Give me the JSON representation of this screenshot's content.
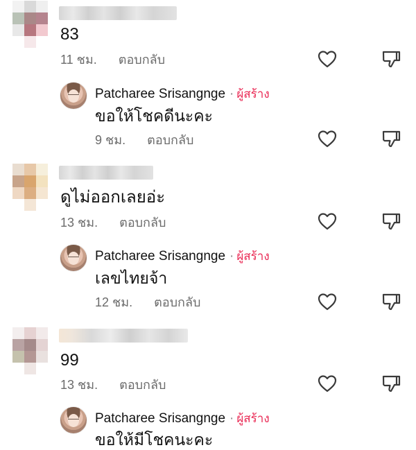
{
  "comments": [
    {
      "text": "83",
      "time": "11 ชม.",
      "reply_label": "ตอบกลับ",
      "reply": {
        "author": "Patcharee Srisangnge",
        "separator": "·",
        "creator_badge": "ผู้สร้าง",
        "text": "ขอให้โชคดีนะคะ",
        "time": "9 ชม.",
        "reply_label": "ตอบกลับ"
      }
    },
    {
      "text": "ดูไม่ออกเลยอ่ะ",
      "time": "13 ชม.",
      "reply_label": "ตอบกลับ",
      "reply": {
        "author": "Patcharee Srisangnge",
        "separator": "·",
        "creator_badge": "ผู้สร้าง",
        "text": "เลขไทยจ้า",
        "time": "12 ชม.",
        "reply_label": "ตอบกลับ"
      }
    },
    {
      "text": "99",
      "time": "13 ชม.",
      "reply_label": "ตอบกลับ",
      "reply": {
        "author": "Patcharee Srisangnge",
        "separator": "·",
        "creator_badge": "ผู้สร้าง",
        "text": "ขอให้มีโชคนะคะ"
      }
    }
  ],
  "icons": {
    "like": "heart-outline-icon",
    "dislike": "thumbs-down-outline-icon"
  },
  "colors": {
    "creator_badge": "#ea2a55",
    "meta_text": "#6b6b6b",
    "icon_stroke": "#3a3a3a"
  }
}
